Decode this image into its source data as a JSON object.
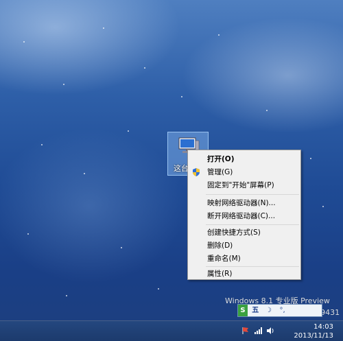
{
  "desktop": {
    "icon_label": "这台电脑"
  },
  "context_menu": {
    "items": [
      {
        "label": "打开(O)"
      },
      {
        "label": "管理(G)"
      },
      {
        "label": "固定到\"开始\"屏幕(P)"
      },
      {
        "label": "映射网络驱动器(N)..."
      },
      {
        "label": "断开网络驱动器(C)..."
      },
      {
        "label": "创建快捷方式(S)"
      },
      {
        "label": "删除(D)"
      },
      {
        "label": "重命名(M)"
      },
      {
        "label": "属性(R)"
      }
    ]
  },
  "watermark": {
    "line1": "Windows 8.1 专业版 Preview",
    "line2": "Build 9431"
  },
  "ime": {
    "lang": "S",
    "mode": "五",
    "moon": "☽",
    "punct": "°,"
  },
  "taskbar": {
    "time": "14:03",
    "date": "2013/11/13"
  },
  "icons": {
    "computer": "computer-icon",
    "shield": "uac-shield-icon",
    "network": "network-icon",
    "volume": "volume-icon",
    "flag": "action-center-flag-icon"
  }
}
